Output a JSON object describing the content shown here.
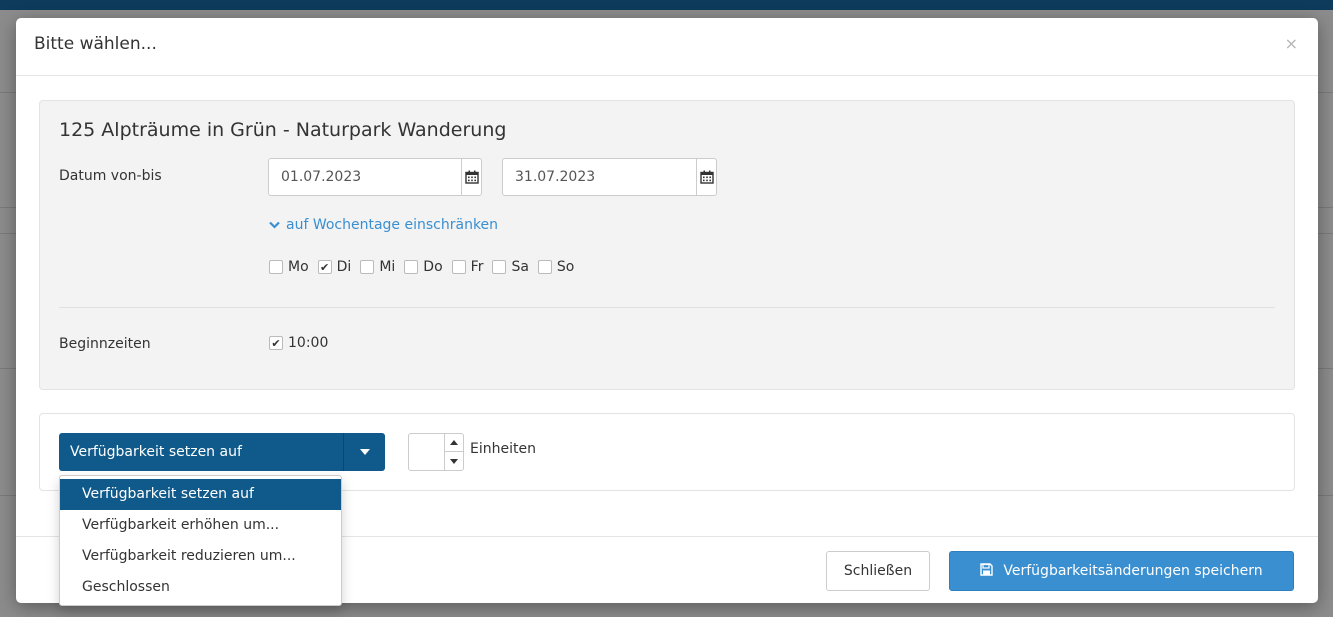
{
  "modal": {
    "title": "Bitte wählen...",
    "close_glyph": "×"
  },
  "product": {
    "title": "125 Alpträume in Grün - Naturpark Wanderung"
  },
  "date_range": {
    "label": "Datum von-bis",
    "from": "01.07.2023",
    "to": "31.07.2023",
    "icon": "calendar-icon"
  },
  "weekday_restrict": {
    "toggle_label": "auf Wochentage einschränken",
    "days": [
      {
        "label": "Mo",
        "checked": false
      },
      {
        "label": "Di",
        "checked": true
      },
      {
        "label": "Mi",
        "checked": false
      },
      {
        "label": "Do",
        "checked": false
      },
      {
        "label": "Fr",
        "checked": false
      },
      {
        "label": "Sa",
        "checked": false
      },
      {
        "label": "So",
        "checked": false
      }
    ]
  },
  "start_times": {
    "label": "Beginnzeiten",
    "time": "10:00",
    "checked": true
  },
  "availability": {
    "selected": "Verfügbarkeit setzen auf",
    "units_label": "Einheiten",
    "units_value": "",
    "options": [
      "Verfügbarkeit setzen auf",
      "Verfügbarkeit erhöhen um...",
      "Verfügbarkeit reduzieren um...",
      "Geschlossen"
    ]
  },
  "footer": {
    "close_label": "Schließen",
    "save_label": "Verfügbarkeitsänderungen speichern",
    "save_icon": "floppy-disk-icon"
  },
  "colors": {
    "primary_dark": "#0f5a8a",
    "primary": "#3a8fd0",
    "link": "#3a8fd0"
  }
}
